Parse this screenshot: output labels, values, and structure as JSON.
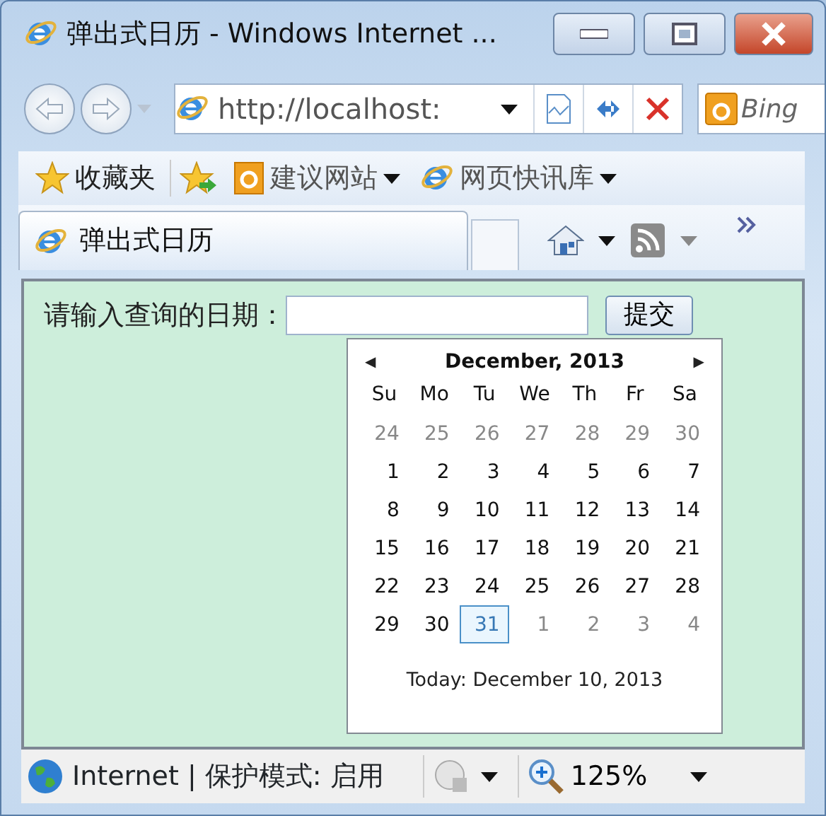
{
  "window": {
    "title": "弹出式日历 - Windows Internet ..."
  },
  "address_bar": {
    "url": "http://localhost:"
  },
  "search": {
    "placeholder": "Bing"
  },
  "favorites_bar": {
    "label": "收藏夹",
    "items": [
      "建议网站",
      "网页快讯库"
    ]
  },
  "tab": {
    "title": "弹出式日历"
  },
  "page": {
    "prompt": "请输入查询的日期：",
    "submit": "提交"
  },
  "calendar": {
    "title": "December, 2013",
    "prev": "◀",
    "next": "▶",
    "weekdays": [
      "Su",
      "Mo",
      "Tu",
      "We",
      "Th",
      "Fr",
      "Sa"
    ],
    "weeks": [
      [
        {
          "day": "24",
          "kind": "other",
          "selected": false
        },
        {
          "day": "25",
          "kind": "other",
          "selected": false
        },
        {
          "day": "26",
          "kind": "other",
          "selected": false
        },
        {
          "day": "27",
          "kind": "other",
          "selected": false
        },
        {
          "day": "28",
          "kind": "other",
          "selected": false
        },
        {
          "day": "29",
          "kind": "other",
          "selected": false
        },
        {
          "day": "30",
          "kind": "other",
          "selected": false
        }
      ],
      [
        {
          "day": "1",
          "kind": "current",
          "selected": false
        },
        {
          "day": "2",
          "kind": "current",
          "selected": false
        },
        {
          "day": "3",
          "kind": "current",
          "selected": false
        },
        {
          "day": "4",
          "kind": "current",
          "selected": false
        },
        {
          "day": "5",
          "kind": "current",
          "selected": false
        },
        {
          "day": "6",
          "kind": "current",
          "selected": false
        },
        {
          "day": "7",
          "kind": "current",
          "selected": false
        }
      ],
      [
        {
          "day": "8",
          "kind": "current",
          "selected": false
        },
        {
          "day": "9",
          "kind": "current",
          "selected": false
        },
        {
          "day": "10",
          "kind": "current",
          "selected": false
        },
        {
          "day": "11",
          "kind": "current",
          "selected": false
        },
        {
          "day": "12",
          "kind": "current",
          "selected": false
        },
        {
          "day": "13",
          "kind": "current",
          "selected": false
        },
        {
          "day": "14",
          "kind": "current",
          "selected": false
        }
      ],
      [
        {
          "day": "15",
          "kind": "current",
          "selected": false
        },
        {
          "day": "16",
          "kind": "current",
          "selected": false
        },
        {
          "day": "17",
          "kind": "current",
          "selected": false
        },
        {
          "day": "18",
          "kind": "current",
          "selected": false
        },
        {
          "day": "19",
          "kind": "current",
          "selected": false
        },
        {
          "day": "20",
          "kind": "current",
          "selected": false
        },
        {
          "day": "21",
          "kind": "current",
          "selected": false
        }
      ],
      [
        {
          "day": "22",
          "kind": "current",
          "selected": false
        },
        {
          "day": "23",
          "kind": "current",
          "selected": false
        },
        {
          "day": "24",
          "kind": "current",
          "selected": false
        },
        {
          "day": "25",
          "kind": "current",
          "selected": false
        },
        {
          "day": "26",
          "kind": "current",
          "selected": false
        },
        {
          "day": "27",
          "kind": "current",
          "selected": false
        },
        {
          "day": "28",
          "kind": "current",
          "selected": false
        }
      ],
      [
        {
          "day": "29",
          "kind": "current",
          "selected": false
        },
        {
          "day": "30",
          "kind": "current",
          "selected": false
        },
        {
          "day": "31",
          "kind": "current",
          "selected": true
        },
        {
          "day": "1",
          "kind": "other",
          "selected": false
        },
        {
          "day": "2",
          "kind": "other",
          "selected": false
        },
        {
          "day": "3",
          "kind": "other",
          "selected": false
        },
        {
          "day": "4",
          "kind": "other",
          "selected": false
        }
      ]
    ],
    "today": "Today: December 10, 2013"
  },
  "status_bar": {
    "zone": "Internet | 保护模式: 启用",
    "zoom": "125%"
  }
}
